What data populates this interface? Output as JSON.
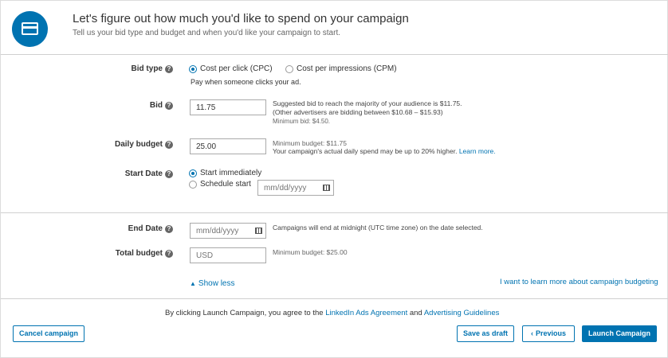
{
  "header": {
    "icon": "credit-card-icon",
    "title": "Let's figure out how much you'd like to spend on your campaign",
    "subtitle": "Tell us your bid type and budget and when you'd like your campaign to start."
  },
  "help_glyph": "?",
  "bid_type": {
    "label": "Bid type",
    "options": [
      "Cost per click (CPC)",
      "Cost per impressions (CPM)"
    ],
    "selected": "Cost per click (CPC)",
    "description": "Pay when someone clicks your ad."
  },
  "bid": {
    "label": "Bid",
    "value": "11.75",
    "hint_line1": "Suggested bid to reach the majority of your audience is $11.75.",
    "hint_line2": "(Other advertisers are bidding between $10.68 – $15.93)",
    "hint_line3": "Minimum bid: $4.50."
  },
  "daily_budget": {
    "label": "Daily budget",
    "value": "25.00",
    "hint_line1": "Minimum budget: $11.75",
    "hint_line2": "Your campaign's actual daily spend may be up to 20% higher.",
    "learn_more": "Learn more."
  },
  "start_date": {
    "label": "Start Date",
    "options": [
      "Start immediately",
      "Schedule start"
    ],
    "selected": "Start immediately",
    "date_placeholder": "mm/dd/yyyy"
  },
  "end_date": {
    "label": "End Date",
    "date_placeholder": "mm/dd/yyyy",
    "hint": "Campaigns will end at midnight (UTC time zone) on the date selected."
  },
  "total_budget": {
    "label": "Total budget",
    "placeholder": "USD",
    "hint": "Minimum budget: $25.00"
  },
  "show_less": "Show less",
  "budgeting_link": "I want to learn more about campaign budgeting",
  "agreement": {
    "prefix": "By clicking Launch Campaign, you agree to the",
    "ads_agreement": "LinkedIn Ads Agreement",
    "and": "and",
    "guidelines": "Advertising Guidelines"
  },
  "buttons": {
    "cancel": "Cancel campaign",
    "save_draft": "Save as draft",
    "previous": "Previous",
    "launch": "Launch Campaign"
  },
  "colors": {
    "accent": "#0073b1",
    "border": "#d0d0d0"
  }
}
